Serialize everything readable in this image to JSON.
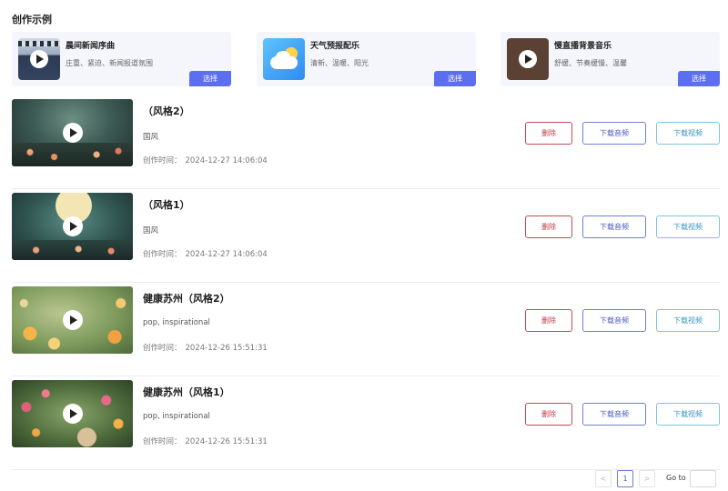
{
  "section_title": "创作示例",
  "examples": [
    {
      "title": "晨间新闻序曲",
      "desc": "庄重、紧迫、新闻报道氛围",
      "select_label": "选择",
      "thumb_icon": "film-play-icon"
    },
    {
      "title": "天气预报配乐",
      "desc": "清新、温暖、阳光",
      "select_label": "选择",
      "thumb_icon": "weather-cloud-sun-icon"
    },
    {
      "title": "慢直播背景音乐",
      "desc": "舒缓、节奏缓慢、温馨",
      "select_label": "选择",
      "thumb_icon": "vinyl-play-icon"
    }
  ],
  "items": [
    {
      "name": "（风格2）",
      "tags": "国风",
      "time_label": "创作时间：",
      "time": "2024-12-27 14:06:04",
      "delete_label": "删除",
      "download_audio_label": "下载音频",
      "download_video_label": "下载视频"
    },
    {
      "name": "（风格1）",
      "tags": "国风",
      "time_label": "创作时间：",
      "time": "2024-12-27 14:06:04",
      "delete_label": "删除",
      "download_audio_label": "下载音频",
      "download_video_label": "下载视频"
    },
    {
      "name": "健康苏州（风格2）",
      "tags": "pop, inspirational",
      "time_label": "创作时间：",
      "time": "2024-12-26 15:51:31",
      "delete_label": "删除",
      "download_audio_label": "下载音频",
      "download_video_label": "下载视频"
    },
    {
      "name": "健康苏州（风格1）",
      "tags": "pop, inspirational",
      "time_label": "创作时间：",
      "time": "2024-12-26 15:51:31",
      "delete_label": "删除",
      "download_audio_label": "下载音频",
      "download_video_label": "下载视频"
    }
  ],
  "pagination": {
    "prev": "<",
    "current_page": "1",
    "next": ">",
    "goto_label": "Go to",
    "goto_value": ""
  },
  "colors": {
    "accent": "#5c6ff0",
    "delete": "#c03a44",
    "audio": "#4a5cc2",
    "video": "#3d96c4"
  }
}
